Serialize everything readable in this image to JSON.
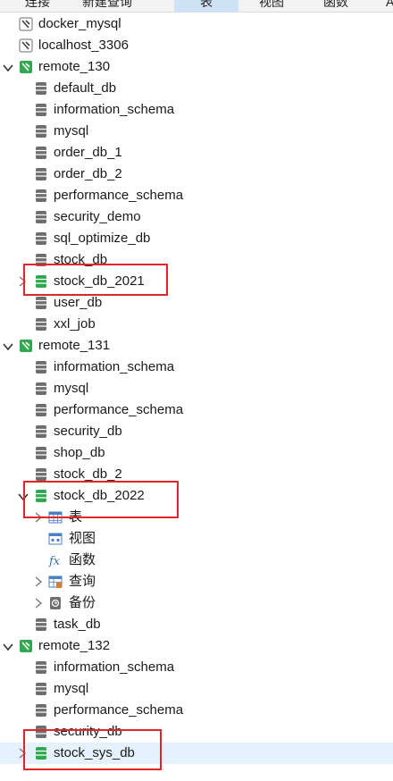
{
  "toolbar": {
    "connect": "连接",
    "new_query": "新建查询",
    "table": "表",
    "view": "视图",
    "function": "函数"
  },
  "connections": [
    {
      "name": "docker_mysql"
    },
    {
      "name": "localhost_3306"
    },
    {
      "name": "remote_130",
      "databases": [
        "default_db",
        "information_schema",
        "mysql",
        "order_db_1",
        "order_db_2",
        "performance_schema",
        "security_demo",
        "sql_optimize_db",
        "stock_db",
        "stock_db_2021",
        "user_db",
        "xxl_job"
      ]
    },
    {
      "name": "remote_131",
      "databases": [
        "information_schema",
        "mysql",
        "performance_schema",
        "security_db",
        "shop_db",
        "stock_db_2",
        "stock_db_2022",
        "task_db"
      ],
      "expanded_db_children": [
        "表",
        "视图",
        "函数",
        "查询",
        "备份"
      ]
    },
    {
      "name": "remote_132",
      "databases": [
        "information_schema",
        "mysql",
        "performance_schema",
        "security_db",
        "stock_sys_db"
      ]
    }
  ],
  "colors": {
    "mysql_green": "#2fa84f",
    "highlight_red": "#e0262b",
    "selection": "#e5f1fc"
  }
}
